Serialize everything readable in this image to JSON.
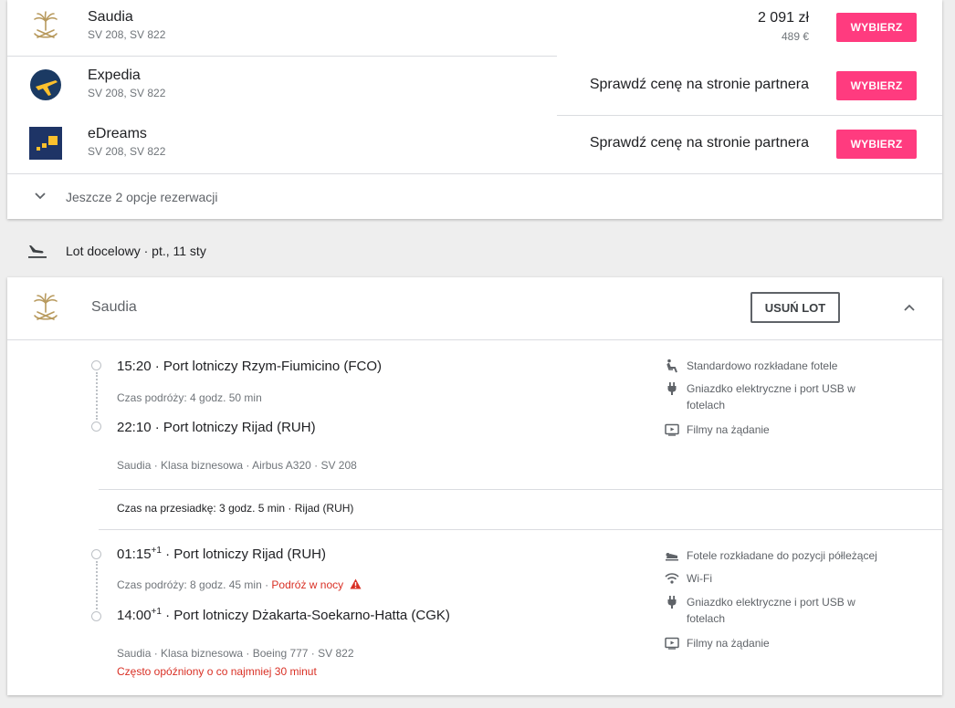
{
  "colors": {
    "accent": "#ff3b7f",
    "warning": "#d93025"
  },
  "providers": [
    {
      "name": "Saudia",
      "flights": "SV 208, SV 822",
      "price": "2 091 zł",
      "price_alt": "489 €",
      "button": "WYBIERZ",
      "logo": "saudia-palm-logo"
    },
    {
      "name": "Expedia",
      "flights": "SV 208, SV 822",
      "partner_text": "Sprawdź cenę na stronie partnera",
      "button": "WYBIERZ",
      "logo": "expedia-plane-logo"
    },
    {
      "name": "eDreams",
      "flights": "SV 208, SV 822",
      "partner_text": "Sprawdź cenę na stronie partnera",
      "button": "WYBIERZ",
      "logo": "edreams-logo"
    }
  ],
  "more_options": {
    "label": "Jeszcze 2 opcje rezerwacji",
    "icon": "chevron-down-icon"
  },
  "destination": {
    "label": "Lot docelowy · pt., 11 sty",
    "icon": "flight-land-icon"
  },
  "flight_card": {
    "airline": "Saudia",
    "remove_label": "USUŃ LOT",
    "segments": [
      {
        "departure": "15:20 · Port lotniczy Rzym-Fiumicino (FCO)",
        "duration": "Czas podróży: 4 godz. 50 min",
        "arrival": "22:10 · Port lotniczy Rijad (RUH)",
        "meta": "Saudia · Klasa biznesowa · Airbus A320 · SV 208",
        "amenities": [
          {
            "icon": "recline-seat-icon",
            "text": "Standardowo rozkładane fotele"
          },
          {
            "icon": "power-plug-icon",
            "text": "Gniazdko elektryczne i port USB w fotelach"
          },
          {
            "icon": "video-icon",
            "text": "Filmy na żądanie"
          }
        ]
      },
      {
        "departure_time": "01:15",
        "departure_plus": "+1",
        "departure_rest": " · Port lotniczy Rijad (RUH)",
        "duration": "Czas podróży: 8 godz. 45 min · ",
        "overnight": "Podróż w nocy",
        "arrival_time": "14:00",
        "arrival_plus": "+1",
        "arrival_rest": " · Port lotniczy Dżakarta-Soekarno-Hatta (CGK)",
        "meta": "Saudia · Klasa biznesowa · Boeing 777 · SV 822",
        "delay": "Często opóźniony o co najmniej 30 minut",
        "amenities": [
          {
            "icon": "lie-flat-seat-icon",
            "text": "Fotele rozkładane do pozycji półleżącej"
          },
          {
            "icon": "wifi-icon",
            "text": "Wi-Fi"
          },
          {
            "icon": "power-plug-icon",
            "text": "Gniazdko elektryczne i port USB w fotelach"
          },
          {
            "icon": "video-icon",
            "text": "Filmy na żądanie"
          }
        ]
      }
    ],
    "layover": "Czas na przesiadkę: 3 godz. 5 min · Rijad (RUH)"
  }
}
